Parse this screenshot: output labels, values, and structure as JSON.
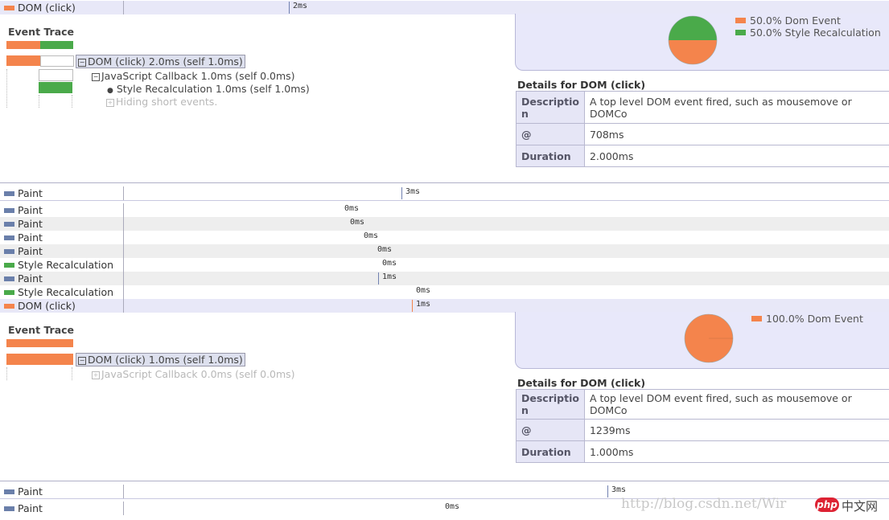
{
  "colors": {
    "dom_event": "#f4844c",
    "style_recalc": "#4aaa4a",
    "paint": "#6a7faa",
    "panel_bg": "#e8e8fa"
  },
  "top_row": {
    "name": "DOM (click)",
    "time": "2ms"
  },
  "trace1": {
    "header": "Event Trace",
    "legend": [
      {
        "label": "50.0% Dom Event",
        "color": "#f4844c"
      },
      {
        "label": "50.0% Style Recalculation",
        "color": "#4aaa4a"
      }
    ],
    "pie": {
      "dom_event": 0.5,
      "style_recalc": 0.5
    },
    "tree": {
      "root": "DOM (click) 2.0ms (self 1.0ms)",
      "child": "JavaScript Callback 1.0ms (self 0.0ms)",
      "grandchild": "Style Recalculation 1.0ms (self 1.0ms)",
      "hidden": "Hiding short events."
    },
    "details_title": "Details for DOM (click)",
    "details": {
      "desc_key": "Descriptio n",
      "desc_val": "A top level DOM event fired, such as mousemove or DOMCo",
      "at_key": "@",
      "at_val": "708ms",
      "dur_key": "Duration",
      "dur_val": "2.000ms"
    }
  },
  "rows": [
    {
      "name": "Paint",
      "time": "3ms",
      "kind": "paint"
    },
    {
      "name": "Paint",
      "time": "0ms",
      "kind": "paint"
    },
    {
      "name": "Paint",
      "time": "0ms",
      "kind": "paint"
    },
    {
      "name": "Paint",
      "time": "0ms",
      "kind": "paint"
    },
    {
      "name": "Paint",
      "time": "0ms",
      "kind": "paint"
    },
    {
      "name": "Style Recalculation",
      "time": "0ms",
      "kind": "style"
    },
    {
      "name": "Paint",
      "time": "1ms",
      "kind": "paint"
    },
    {
      "name": "Style Recalculation",
      "time": "0ms",
      "kind": "style"
    },
    {
      "name": "DOM (click)",
      "time": "1ms",
      "kind": "dom"
    }
  ],
  "trace2": {
    "header": "Event Trace",
    "legend": [
      {
        "label": "100.0% Dom Event",
        "color": "#f4844c"
      }
    ],
    "pie": {
      "dom_event": 1.0
    },
    "tree": {
      "root": "DOM (click) 1.0ms (self 1.0ms)",
      "hidden": "JavaScript Callback 0.0ms (self 0.0ms)"
    },
    "details_title": "Details for DOM (click)",
    "details": {
      "desc_key": "Descriptio n",
      "desc_val": "A top level DOM event fired, such as mousemove or DOMCo",
      "at_key": "@",
      "at_val": "1239ms",
      "dur_key": "Duration",
      "dur_val": "1.000ms"
    }
  },
  "bottom_rows": [
    {
      "name": "Paint",
      "time": "3ms",
      "kind": "paint"
    },
    {
      "name": "Paint",
      "time": "0ms",
      "kind": "paint"
    }
  ],
  "watermark": {
    "url": "http://blog.csdn.net/Wir",
    "logo": "php",
    "site": "中文网"
  }
}
